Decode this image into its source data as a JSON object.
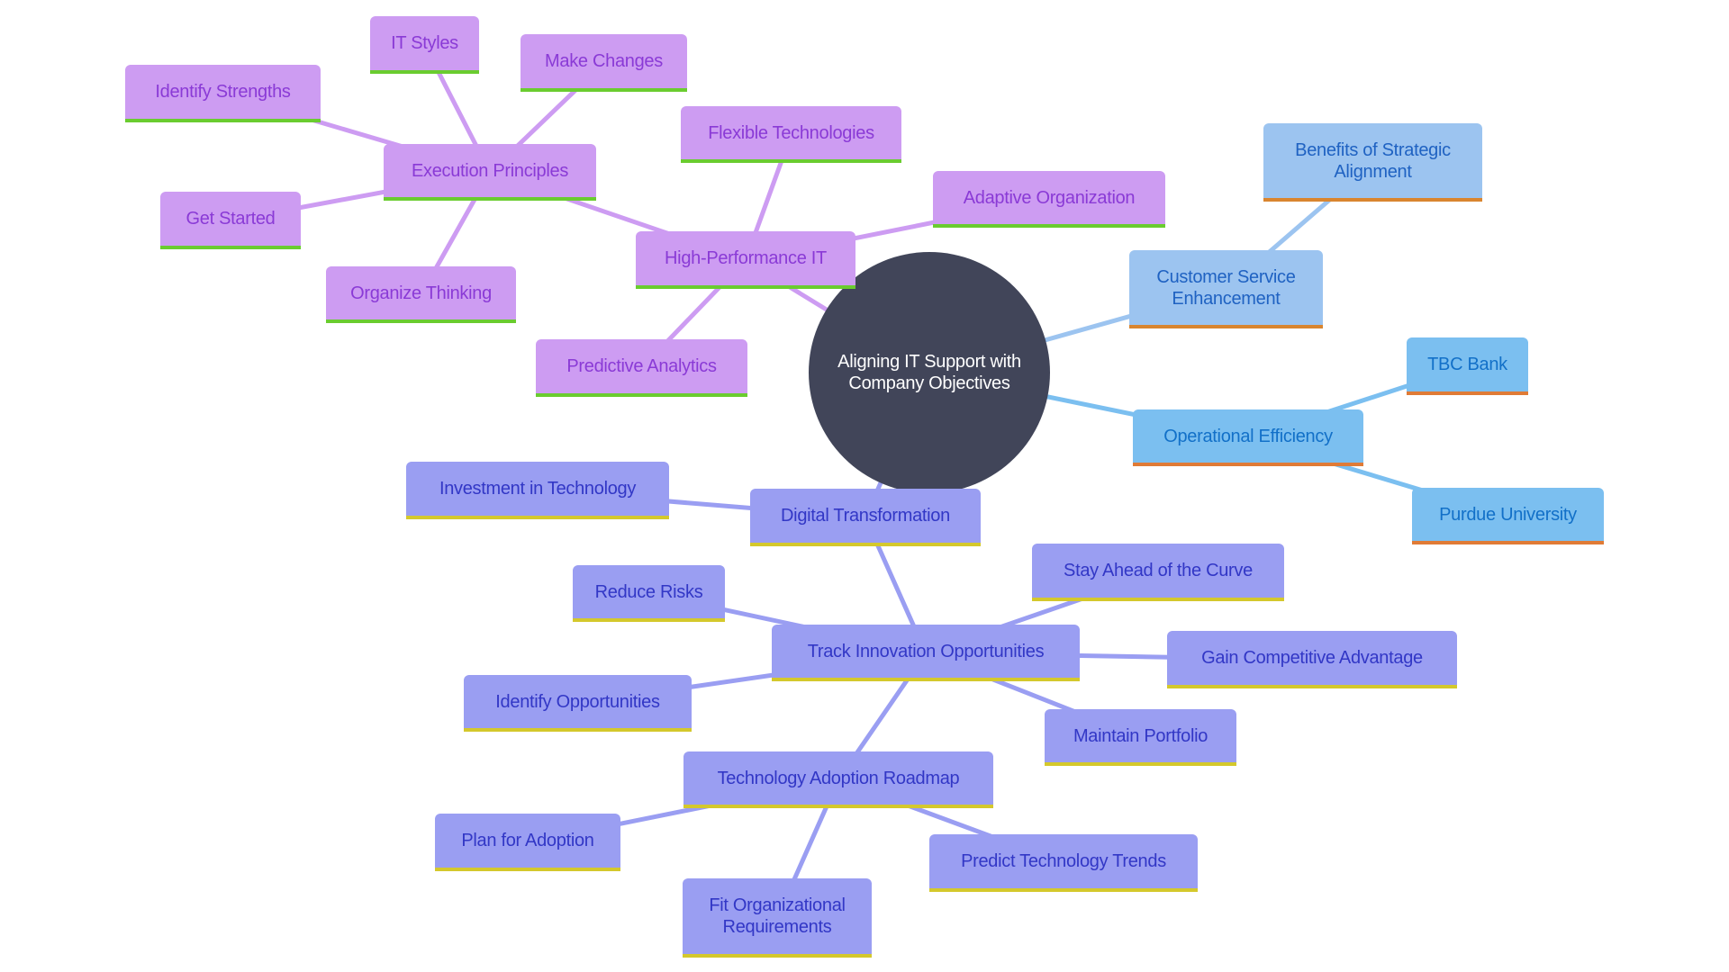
{
  "diagram": {
    "type": "mindmap",
    "root": {
      "id": "root",
      "label": "Aligning IT Support with\nCompany Objectives",
      "color": "#414559",
      "text_color": "#ffffff"
    },
    "branches": {
      "purple": {
        "fill": "#cd9cf2",
        "text": "#8a3ad6",
        "border": "#6acc2f",
        "link": "#cd9cf2"
      },
      "lightblue": {
        "fill": "#9cc4f0",
        "text": "#1f62c2",
        "border": "#d9852f",
        "link": "#9cc4f0"
      },
      "skyblue": {
        "fill": "#7bbff0",
        "text": "#1270c8",
        "border": "#e07b36",
        "link": "#7bbff0"
      },
      "periwinkle": {
        "fill": "#9a9ef2",
        "text": "#3237c6",
        "border": "#d4c82c",
        "link": "#9a9ef2"
      }
    },
    "nodes": [
      {
        "id": "high-performance-it",
        "label": "High-Performance IT",
        "parent": "root",
        "branch": "purple"
      },
      {
        "id": "execution-principles",
        "label": "Execution Principles",
        "parent": "high-performance-it",
        "branch": "purple"
      },
      {
        "id": "it-styles",
        "label": "IT Styles",
        "parent": "execution-principles",
        "branch": "purple"
      },
      {
        "id": "make-changes",
        "label": "Make Changes",
        "parent": "execution-principles",
        "branch": "purple"
      },
      {
        "id": "identify-strengths",
        "label": "Identify Strengths",
        "parent": "execution-principles",
        "branch": "purple"
      },
      {
        "id": "get-started",
        "label": "Get Started",
        "parent": "execution-principles",
        "branch": "purple"
      },
      {
        "id": "organize-thinking",
        "label": "Organize Thinking",
        "parent": "execution-principles",
        "branch": "purple"
      },
      {
        "id": "flexible-technologies",
        "label": "Flexible Technologies",
        "parent": "high-performance-it",
        "branch": "purple"
      },
      {
        "id": "adaptive-organization",
        "label": "Adaptive Organization",
        "parent": "high-performance-it",
        "branch": "purple"
      },
      {
        "id": "predictive-analytics",
        "label": "Predictive Analytics",
        "parent": "high-performance-it",
        "branch": "purple"
      },
      {
        "id": "customer-service-enhancement",
        "label": "Customer Service\nEnhancement",
        "parent": "root",
        "branch": "lightblue"
      },
      {
        "id": "benefits-of-strategic-alignment",
        "label": "Benefits of Strategic\nAlignment",
        "parent": "customer-service-enhancement",
        "branch": "lightblue"
      },
      {
        "id": "operational-efficiency",
        "label": "Operational Efficiency",
        "parent": "root",
        "branch": "skyblue"
      },
      {
        "id": "tbc-bank",
        "label": "TBC Bank",
        "parent": "operational-efficiency",
        "branch": "skyblue"
      },
      {
        "id": "purdue-university",
        "label": "Purdue University",
        "parent": "operational-efficiency",
        "branch": "skyblue"
      },
      {
        "id": "digital-transformation",
        "label": "Digital Transformation",
        "parent": "root",
        "branch": "periwinkle"
      },
      {
        "id": "investment-in-technology",
        "label": "Investment in Technology",
        "parent": "digital-transformation",
        "branch": "periwinkle"
      },
      {
        "id": "track-innovation-opportunities",
        "label": "Track Innovation Opportunities",
        "parent": "digital-transformation",
        "branch": "periwinkle"
      },
      {
        "id": "reduce-risks",
        "label": "Reduce Risks",
        "parent": "track-innovation-opportunities",
        "branch": "periwinkle"
      },
      {
        "id": "stay-ahead-of-the-curve",
        "label": "Stay Ahead of the Curve",
        "parent": "track-innovation-opportunities",
        "branch": "periwinkle"
      },
      {
        "id": "gain-competitive-advantage",
        "label": "Gain Competitive Advantage",
        "parent": "track-innovation-opportunities",
        "branch": "periwinkle"
      },
      {
        "id": "identify-opportunities",
        "label": "Identify Opportunities",
        "parent": "track-innovation-opportunities",
        "branch": "periwinkle"
      },
      {
        "id": "maintain-portfolio",
        "label": "Maintain Portfolio",
        "parent": "track-innovation-opportunities",
        "branch": "periwinkle"
      },
      {
        "id": "technology-adoption-roadmap",
        "label": "Technology Adoption Roadmap",
        "parent": "track-innovation-opportunities",
        "branch": "periwinkle"
      },
      {
        "id": "plan-for-adoption",
        "label": "Plan for Adoption",
        "parent": "technology-adoption-roadmap",
        "branch": "periwinkle"
      },
      {
        "id": "predict-technology-trends",
        "label": "Predict Technology Trends",
        "parent": "technology-adoption-roadmap",
        "branch": "periwinkle"
      },
      {
        "id": "fit-organizational-requirements",
        "label": "Fit Organizational\nRequirements",
        "parent": "technology-adoption-roadmap",
        "branch": "periwinkle"
      }
    ]
  }
}
